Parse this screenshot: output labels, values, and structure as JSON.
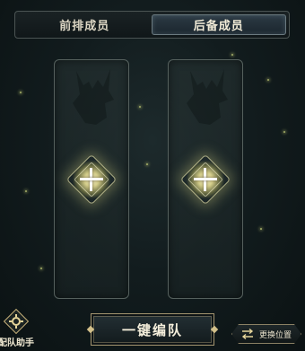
{
  "tabs": [
    {
      "label": "前排成员",
      "active": false
    },
    {
      "label": "后备成员",
      "active": true
    }
  ],
  "slots": [
    {
      "name": "slot-1",
      "icon": "plus-icon"
    },
    {
      "name": "slot-2",
      "icon": "plus-icon"
    }
  ],
  "footer": {
    "assist_label": "配队助手",
    "onekey_label": "一键编队",
    "swap_label": "更换位置"
  },
  "colors": {
    "accent_gold": "#d3c08a",
    "background": "#121c1e",
    "active_tab": "#2c3a44"
  }
}
